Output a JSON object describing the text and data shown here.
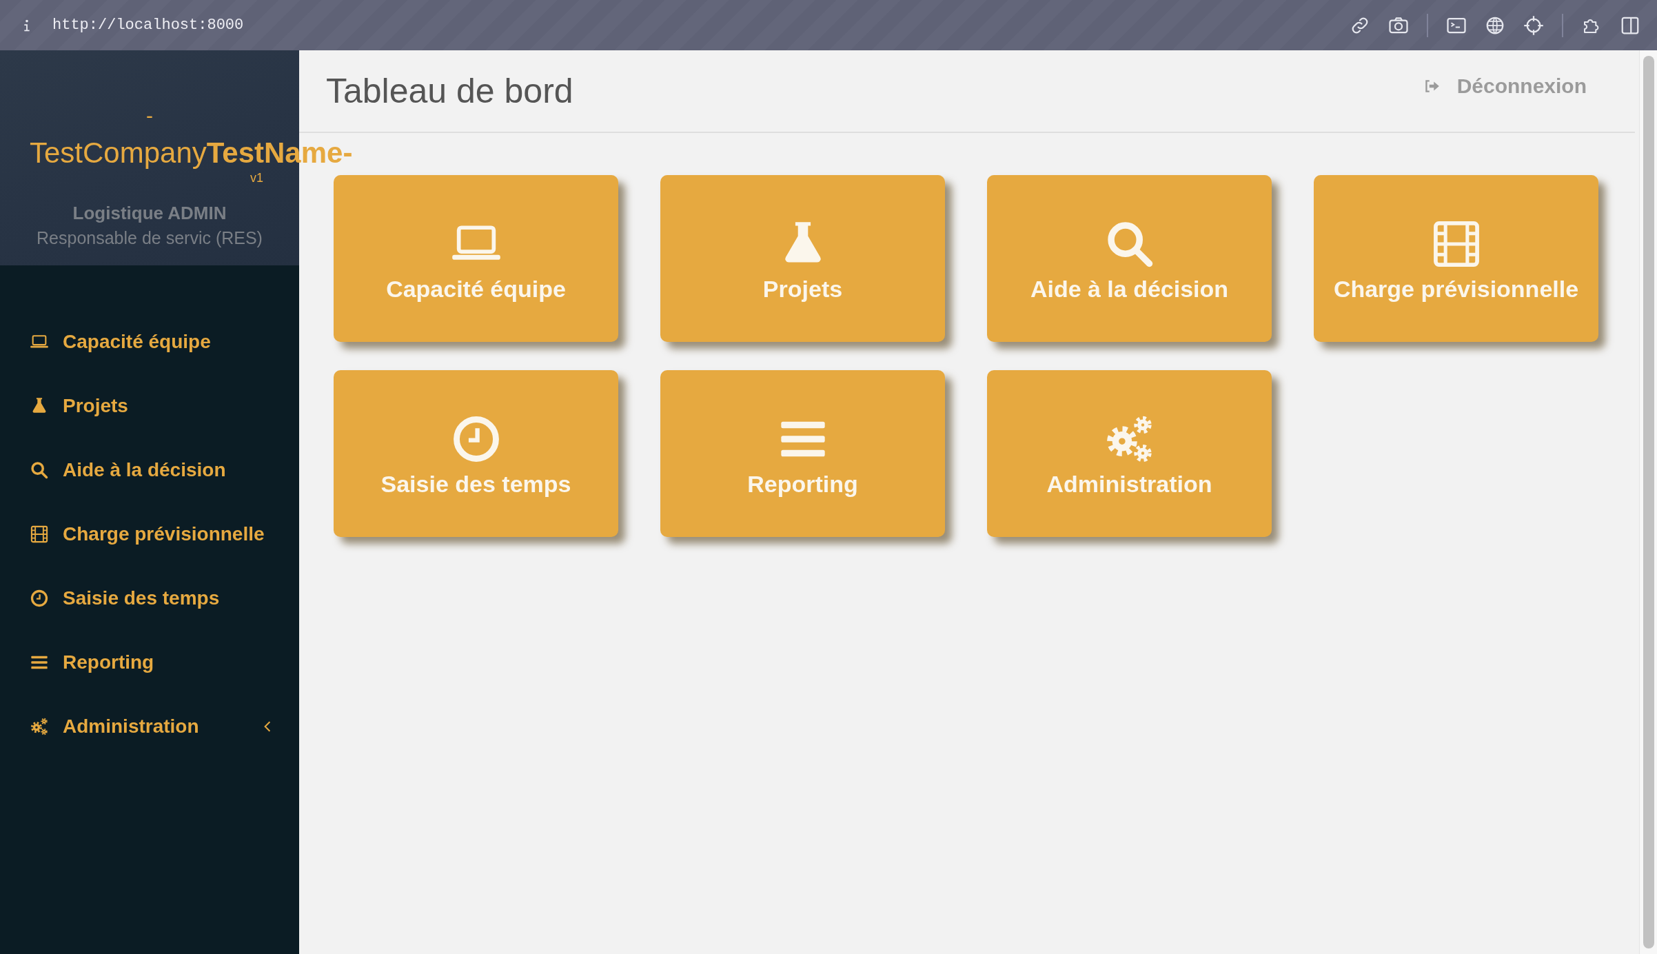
{
  "browser": {
    "url": "http://localhost:8000"
  },
  "sidebar": {
    "brand": {
      "prefix": "-",
      "company": "TestCompany",
      "name": "TestName-",
      "version": "v1"
    },
    "user": {
      "name": "Logistique ADMIN",
      "role": "Responsable de servic (RES)"
    },
    "items": [
      {
        "label": "Capacité équipe",
        "kind": "laptop",
        "has_submenu": false
      },
      {
        "label": "Projets",
        "kind": "flask",
        "has_submenu": false
      },
      {
        "label": "Aide à la décision",
        "kind": "search",
        "has_submenu": false
      },
      {
        "label": "Charge prévisionnelle",
        "kind": "film",
        "has_submenu": false
      },
      {
        "label": "Saisie des temps",
        "kind": "clock",
        "has_submenu": false
      },
      {
        "label": "Reporting",
        "kind": "bars",
        "has_submenu": false
      },
      {
        "label": "Administration",
        "kind": "cogs",
        "has_submenu": true
      }
    ]
  },
  "header": {
    "title": "Tableau de bord",
    "logout": "Déconnexion"
  },
  "tiles": [
    {
      "label": "Capacité équipe",
      "kind": "laptop"
    },
    {
      "label": "Projets",
      "kind": "flask"
    },
    {
      "label": "Aide à la décision",
      "kind": "search"
    },
    {
      "label": "Charge prévisionnelle",
      "kind": "film"
    },
    {
      "label": "Saisie des temps",
      "kind": "clock"
    },
    {
      "label": "Reporting",
      "kind": "bars"
    },
    {
      "label": "Administration",
      "kind": "cogs"
    }
  ]
}
